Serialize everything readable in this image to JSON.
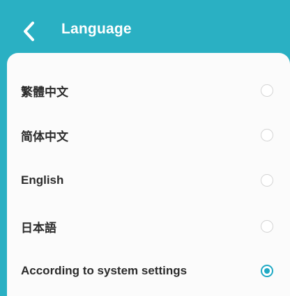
{
  "header": {
    "title": "Language",
    "back_icon": "chevron-left-icon"
  },
  "colors": {
    "header_bg": "#2ab0c3",
    "accent": "#1fa9c4",
    "panel_bg": "#fbfbfb",
    "text": "#2b2b2b",
    "radio_border": "#d4d4d4"
  },
  "languages": [
    {
      "label": "繁體中文",
      "selected": false
    },
    {
      "label": "简体中文",
      "selected": false
    },
    {
      "label": "English",
      "selected": false
    },
    {
      "label": "日本語",
      "selected": false
    },
    {
      "label": "According to system settings",
      "selected": true
    }
  ]
}
